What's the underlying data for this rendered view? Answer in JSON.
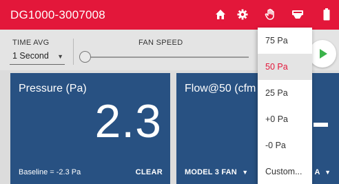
{
  "appbar": {
    "title": "DG1000-3007008",
    "icons": [
      "home-icon",
      "gear-icon",
      "hand-icon",
      "device-icon",
      "battery-icon"
    ],
    "color": "#e3173a"
  },
  "controls": {
    "time_avg_label": "TIME AVG",
    "time_avg_value": "1 Second",
    "fan_speed_label": "FAN SPEED",
    "fan_speed_level": 0
  },
  "cards": {
    "pressure": {
      "title": "Pressure (Pa)",
      "value": "2.3",
      "baseline": "Baseline = -2.3 Pa",
      "clear_label": "CLEAR"
    },
    "flow": {
      "title": "Flow@50 (cfm",
      "value": "-",
      "model_label": "MODEL 3 FAN",
      "range_label": "A"
    },
    "color": "#285182"
  },
  "menu": {
    "items": [
      "75 Pa",
      "50 Pa",
      "25 Pa",
      "+0 Pa",
      "-0 Pa",
      "Custom..."
    ],
    "selected": "50 Pa"
  },
  "accent_green": "#3bb34a"
}
